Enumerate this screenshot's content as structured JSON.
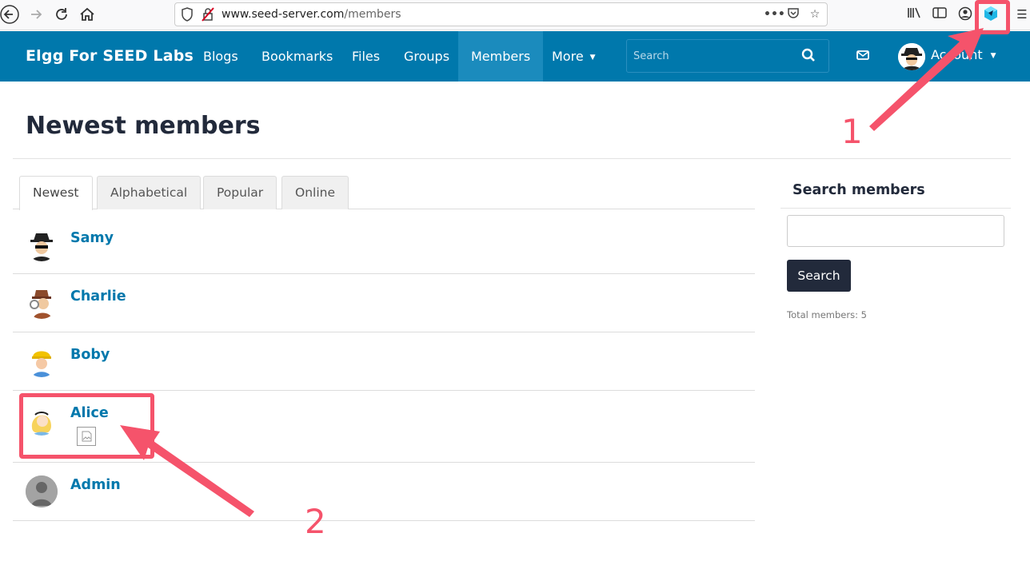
{
  "browser": {
    "url_host": "www.seed-server.com",
    "url_path": "/members"
  },
  "site": {
    "brand": "Elgg For SEED Labs",
    "menu": [
      {
        "label": "Blogs"
      },
      {
        "label": "Bookmarks"
      },
      {
        "label": "Files"
      },
      {
        "label": "Groups"
      },
      {
        "label": "Members",
        "active": true
      },
      {
        "label": "More"
      }
    ],
    "search_placeholder": "Search",
    "account_label": "Account"
  },
  "page": {
    "title": "Newest members",
    "tabs": [
      {
        "label": "Newest",
        "active": true
      },
      {
        "label": "Alphabetical"
      },
      {
        "label": "Popular"
      },
      {
        "label": "Online"
      }
    ],
    "members": [
      {
        "name": "Samy"
      },
      {
        "name": "Charlie"
      },
      {
        "name": "Boby"
      },
      {
        "name": "Alice"
      },
      {
        "name": "Admin"
      }
    ]
  },
  "sidebar": {
    "title": "Search members",
    "button": "Search",
    "total": "Total members: 5"
  },
  "annotations": {
    "label_1": "1",
    "label_2": "2",
    "color": "#f5536b"
  },
  "colors": {
    "header": "#0078ac",
    "active_menu": "#1b8bbd",
    "link": "#0078ac",
    "dark_button": "#222a3b"
  }
}
